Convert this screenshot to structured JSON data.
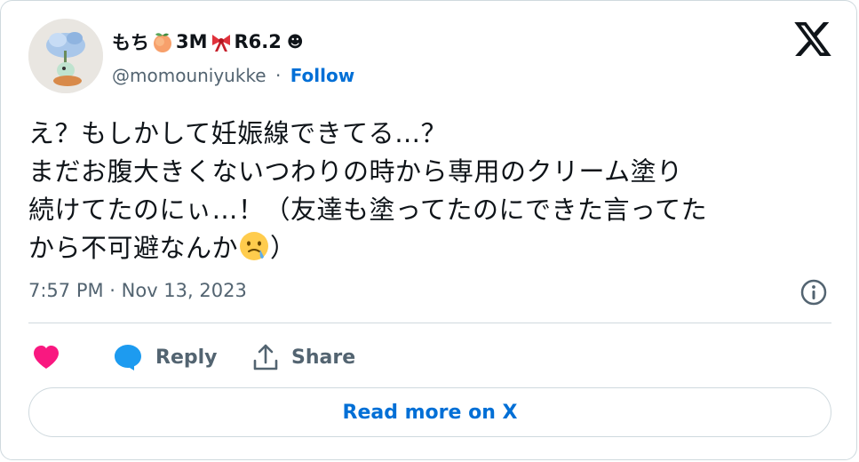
{
  "author": {
    "display_name_part1": "もち",
    "display_name_part2": "3M",
    "display_name_part3": "R6.2",
    "display_name_symbol": "☻",
    "handle": "@momouniyukke",
    "separator": "·",
    "follow_label": "Follow",
    "avatar": "avatar-photo"
  },
  "tweet": {
    "lines": [
      "え？もしかして妊娠線できてる…？",
      "まだお腹大きくないつわりの時から専用のクリーム塗り",
      "続けてたのにぃ…！（友達も塗ってたのにできた言ってた",
      "から不可避なんか"
    ],
    "closing": "）",
    "emoji": "face-holding-back-tears",
    "timestamp": "7:57 PM · Nov 13, 2023"
  },
  "actions": {
    "like_icon": "heart-icon",
    "reply_label": "Reply",
    "share_label": "Share"
  },
  "read_more_label": "Read more on X",
  "colors": {
    "accent": "#006fd6",
    "like": "#f91880",
    "reply_icon": "#1d9bf0",
    "muted": "#536471",
    "border": "#cfd9de"
  }
}
